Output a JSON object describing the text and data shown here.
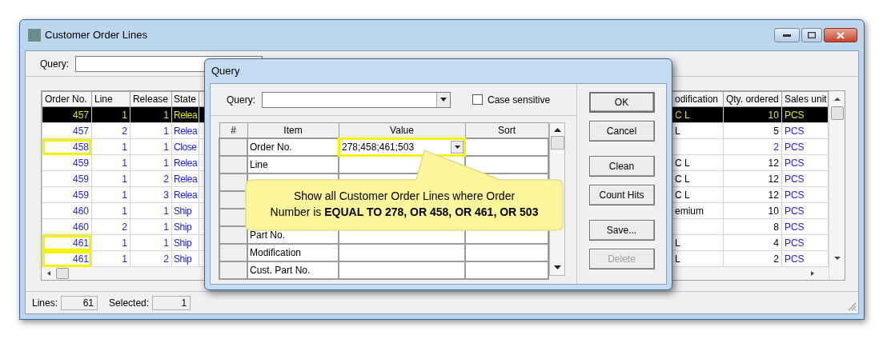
{
  "window": {
    "title": "Customer Order Lines",
    "query_label": "Query:"
  },
  "table": {
    "columns": [
      "Order No.",
      "Line",
      "Release",
      "State",
      "odification",
      "Qty. ordered",
      "Sales unit"
    ],
    "rows": [
      {
        "order_no": "457",
        "line": "1",
        "release": "1",
        "state": "Relea",
        "modification": "C L",
        "qty": "10",
        "unit": "PCS",
        "selected": true,
        "highlighted": false
      },
      {
        "order_no": "457",
        "line": "2",
        "release": "1",
        "state": "Relea",
        "modification": "L",
        "qty": "5",
        "unit": "PCS",
        "selected": false,
        "highlighted": false
      },
      {
        "order_no": "458",
        "line": "1",
        "release": "1",
        "state": "Close",
        "qty": "2",
        "unit": "PCS",
        "selected": false,
        "highlighted": true
      },
      {
        "order_no": "459",
        "line": "1",
        "release": "1",
        "state": "Relea",
        "modification": "C L",
        "qty": "12",
        "unit": "PCS",
        "selected": false,
        "highlighted": false
      },
      {
        "order_no": "459",
        "line": "1",
        "release": "2",
        "state": "Relea",
        "modification": "C L",
        "qty": "12",
        "unit": "PCS",
        "selected": false,
        "highlighted": false
      },
      {
        "order_no": "459",
        "line": "1",
        "release": "3",
        "state": "Relea",
        "modification": "C L",
        "qty": "12",
        "unit": "PCS",
        "selected": false,
        "highlighted": false
      },
      {
        "order_no": "460",
        "line": "1",
        "release": "1",
        "state": "Ship",
        "modification": "emium",
        "qty": "10",
        "unit": "PCS",
        "selected": false,
        "highlighted": false
      },
      {
        "order_no": "460",
        "line": "2",
        "release": "1",
        "state": "Ship",
        "qty": "8",
        "unit": "PCS",
        "selected": false,
        "highlighted": false
      },
      {
        "order_no": "461",
        "line": "1",
        "release": "1",
        "state": "Ship",
        "modification": "L",
        "qty": "4",
        "unit": "PCS",
        "selected": false,
        "highlighted": true
      },
      {
        "order_no": "461",
        "line": "1",
        "release": "2",
        "state": "Ship",
        "modification": "L",
        "qty": "2",
        "unit": "PCS",
        "selected": false,
        "highlighted": true
      }
    ]
  },
  "status_bar": {
    "lines_label": "Lines:",
    "lines": "61",
    "selected_label": "Selected:",
    "selected": "1"
  },
  "dialog": {
    "title": "Query",
    "query_label": "Query:",
    "case_sensitive": {
      "label": "Case sensitive",
      "checked": false
    },
    "grid": {
      "columns": [
        "#",
        "Item",
        "Value",
        "Sort"
      ],
      "rows": [
        {
          "item": "Order No.",
          "value": "278;458;461;503",
          "highlighted": true
        },
        {
          "item": "Line"
        },
        {},
        {},
        {},
        {
          "item": "Part No."
        },
        {
          "item": "Modification"
        },
        {
          "item": "Cust. Part No."
        }
      ]
    },
    "buttons": [
      {
        "label": "OK",
        "disabled": false
      },
      {
        "label": "Cancel",
        "disabled": false
      },
      {
        "label": "Clean",
        "disabled": false
      },
      {
        "label": "Count Hits",
        "disabled": false
      },
      {
        "label": "Save...",
        "disabled": false
      },
      {
        "label": "Delete",
        "disabled": true
      }
    ]
  },
  "callout": {
    "lines": [
      "Show all Customer Order Lines where Order",
      "Number is **EQUAL TO 278, OR 458, OR 461, OR 503**"
    ]
  }
}
